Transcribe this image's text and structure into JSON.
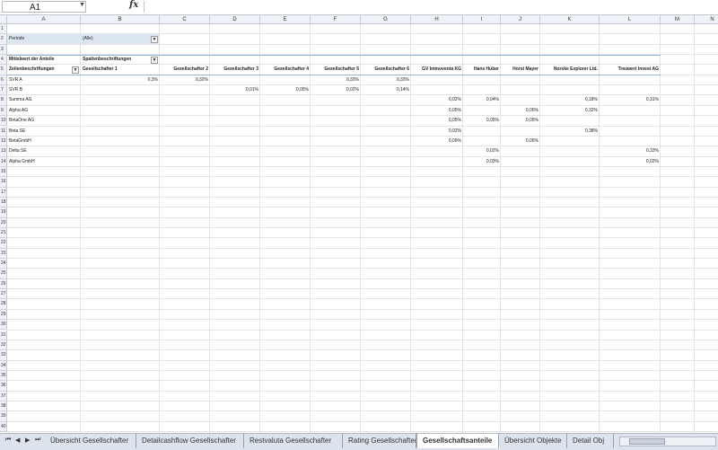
{
  "formula_bar": {
    "name_box": "A1",
    "fx": "fx"
  },
  "columns": [
    "A",
    "B",
    "C",
    "D",
    "E",
    "F",
    "G",
    "H",
    "I",
    "J",
    "K",
    "L",
    "M",
    "N"
  ],
  "rows": [
    "1",
    "2",
    "3",
    "4",
    "5",
    "6",
    "7",
    "8",
    "9",
    "10",
    "11",
    "12",
    "13",
    "14",
    "15",
    "16",
    "17",
    "18",
    "19",
    "20",
    "21",
    "22",
    "23",
    "24",
    "25",
    "26",
    "27",
    "28",
    "29",
    "30",
    "31",
    "32",
    "33",
    "34",
    "35",
    "36",
    "37",
    "38",
    "39",
    "40"
  ],
  "pivot": {
    "filter_label": "Periode",
    "filter_value": "(Alle)",
    "value_label": "Mittelwert der Anteile",
    "col_label": "Spaltenbeschriftungen",
    "row_label": "Zeilenbeschriftungen",
    "col_headers": [
      "Gesellschafter 1",
      "Gesellschafter 2",
      "Gesellschafter 3",
      "Gesellschafter 4",
      "Gesellschafter 5",
      "Gesellschafter 6",
      "GV Immoventa KG",
      "Hans Huber",
      "Horst Mayer",
      "Norske Explorer Ltd.",
      "Treuwert Invest AG"
    ],
    "rows": [
      {
        "label": "SVR A",
        "values": [
          "0,3%",
          "0,32%",
          "",
          "",
          "0,33%",
          "0,33%",
          "",
          "",
          "",
          "",
          ""
        ]
      },
      {
        "label": "SVR B",
        "values": [
          "",
          "",
          "0,01%",
          "0,05%",
          "0,02%",
          "0,14%",
          "",
          "",
          "",
          "",
          ""
        ]
      },
      {
        "label": "Summa AG",
        "values": [
          "",
          "",
          "",
          "",
          "",
          "",
          "0,02%",
          "0,04%",
          "",
          "0,18%",
          "0,31%"
        ]
      },
      {
        "label": "Alpha AG",
        "values": [
          "",
          "",
          "",
          "",
          "",
          "",
          "0,05%",
          "",
          "0,05%",
          "0,32%",
          ""
        ]
      },
      {
        "label": "BetaOne AG",
        "values": [
          "",
          "",
          "",
          "",
          "",
          "",
          "0,05%",
          "0,05%",
          "0,05%",
          "",
          ""
        ]
      },
      {
        "label": "Beta SE",
        "values": [
          "",
          "",
          "",
          "",
          "",
          "",
          "0,02%",
          "",
          "",
          "0,38%",
          ""
        ]
      },
      {
        "label": "BetaGmbH",
        "values": [
          "",
          "",
          "",
          "",
          "",
          "",
          "0,09%",
          "",
          "0,05%",
          "",
          ""
        ]
      },
      {
        "label": "Delta SE",
        "values": [
          "",
          "",
          "",
          "",
          "",
          "",
          "",
          "0,02%",
          "",
          "",
          "0,33%"
        ]
      },
      {
        "label": "Alpha GmbH",
        "values": [
          "",
          "",
          "",
          "",
          "",
          "",
          "",
          "0,03%",
          "",
          "",
          "0,02%"
        ]
      }
    ]
  },
  "tabs": {
    "nav": [
      "⏮",
      "◀",
      "▶",
      "⏭"
    ],
    "items": [
      "Übersicht Gesellschafter",
      "Detailcashflow Gesellschafter",
      "Restvaluta Gesellschafter",
      "Rating Gesellschafter",
      "Gesellschaftsanteile",
      "Übersicht Objekte",
      "Detail Obj"
    ],
    "active_index": 4
  }
}
